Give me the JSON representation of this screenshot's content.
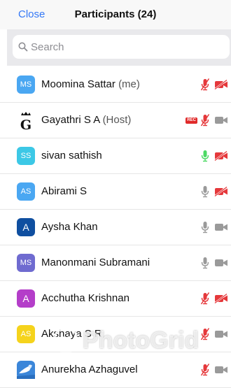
{
  "header": {
    "close_label": "Close",
    "title": "Participants (24)"
  },
  "search": {
    "placeholder": "Search"
  },
  "participants": [
    {
      "initials": "MS",
      "avatar_color": "#4aa7f2",
      "name": "Moomina Sattar",
      "suffix": "(me)",
      "mic": "muted",
      "video": "off",
      "rec": false
    },
    {
      "initials": "G",
      "avatar_color": "transparent",
      "name": "Gayathri S A",
      "suffix": "(Host)",
      "mic": "muted",
      "video": "on",
      "rec": true,
      "rec_label": "REC"
    },
    {
      "initials": "SS",
      "avatar_color": "#3cc8e6",
      "name": "sivan sathish",
      "suffix": "",
      "mic": "active",
      "video": "off",
      "rec": false
    },
    {
      "initials": "AS",
      "avatar_color": "#4aa7f2",
      "name": "Abirami S",
      "suffix": "",
      "mic": "on",
      "video": "off",
      "rec": false
    },
    {
      "initials": "A",
      "avatar_color": "#0f4fa0",
      "name": "Aysha Khan",
      "suffix": "",
      "mic": "on",
      "video": "on",
      "rec": false
    },
    {
      "initials": "MS",
      "avatar_color": "#6f6bd0",
      "name": "Manonmani Subramani",
      "suffix": "",
      "mic": "on",
      "video": "on",
      "rec": false
    },
    {
      "initials": "A",
      "avatar_color": "#b43ec9",
      "name": "Acchutha Krishnan",
      "suffix": "",
      "mic": "muted",
      "video": "off",
      "rec": false
    },
    {
      "initials": "AS",
      "avatar_color": "#f5d31c",
      "name": "Akshaya S R",
      "suffix": "",
      "mic": "muted",
      "video": "on",
      "rec": false
    },
    {
      "initials": "",
      "avatar_color": "#3b86d9",
      "name": "Anurekha Azhaguvel",
      "suffix": "",
      "mic": "muted",
      "video": "on",
      "rec": false
    }
  ],
  "watermark": "PhotoGrid",
  "colors": {
    "accent": "#3478f6",
    "muted_red": "#e5383b",
    "active_green": "#4cd964",
    "icon_gray": "#9a9a9a"
  }
}
